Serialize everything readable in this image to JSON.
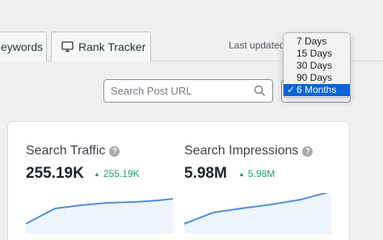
{
  "tabs": [
    {
      "label": "eywords"
    },
    {
      "label": "Rank Tracker",
      "icon": "monitor-icon"
    }
  ],
  "header": {
    "last_updated": "Last updated"
  },
  "search": {
    "placeholder": "Search Post URL",
    "icon": "search-icon"
  },
  "date_range": {
    "options": [
      "7 Days",
      "15 Days",
      "30 Days",
      "90 Days",
      "6 Months"
    ],
    "selected": "6 Months",
    "check": "✓"
  },
  "metrics": [
    {
      "title": "Search Traffic",
      "value": "255.19K",
      "delta": "255.19K",
      "trend": "up"
    },
    {
      "title": "Search Impressions",
      "value": "5.98M",
      "delta": "5.98M",
      "trend": "up"
    }
  ],
  "colors": {
    "accent": "#0a64d6",
    "positive": "#22a06b",
    "spark_line": "#4f8ed6"
  }
}
